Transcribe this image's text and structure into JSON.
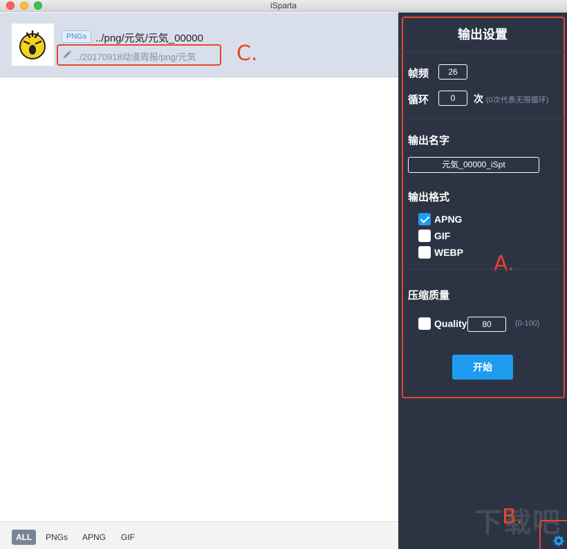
{
  "window": {
    "title": "iSparta"
  },
  "file": {
    "tag": "PNGs",
    "name": "../png/元気/元気_00000",
    "output_path": "../20170918动漫周报/png/元気"
  },
  "annotations": {
    "a": "A.",
    "b": "B.",
    "c": "C."
  },
  "filter_tabs": [
    {
      "label": "ALL",
      "active": true
    },
    {
      "label": "PNGs",
      "active": false
    },
    {
      "label": "APNG",
      "active": false
    },
    {
      "label": "GIF",
      "active": false
    }
  ],
  "settings": {
    "title": "输出设置",
    "frame_rate_label": "帧频",
    "frame_rate": "26",
    "loop_label": "循环",
    "loop": "0",
    "loop_unit": "次",
    "loop_hint": "(0次代表无限循环)",
    "output_name_label": "输出名字",
    "output_name": "元気_00000_iSpt",
    "output_format_label": "输出格式",
    "formats": [
      {
        "label": "APNG",
        "checked": true
      },
      {
        "label": "GIF",
        "checked": false
      },
      {
        "label": "WEBP",
        "checked": false
      }
    ],
    "compression_label": "压缩质量",
    "quality_label": "Quality",
    "quality": "80",
    "quality_hint": "(0-100)",
    "start_label": "开始"
  },
  "watermark": "下载吧",
  "colors": {
    "panel_bg": "#2c3444",
    "accent": "#1e9cf0",
    "annotation": "#e8452a",
    "row_bg": "#d9dfea"
  },
  "icons": {
    "thumbnail": "emoji-face-icon",
    "edit": "pencil-icon",
    "settings": "gear-icon"
  }
}
